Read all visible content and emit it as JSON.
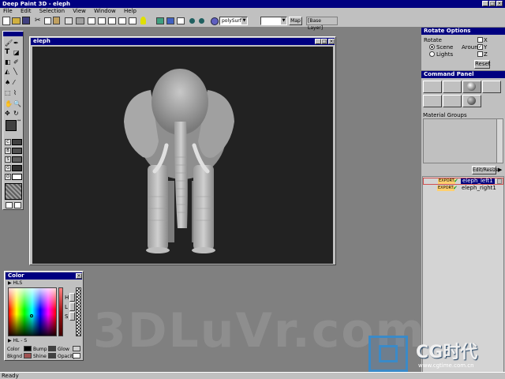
{
  "app": {
    "title": "Deep Paint 3D - eleph",
    "title_controls": [
      "_",
      "□",
      "×"
    ]
  },
  "menu": [
    "File",
    "Edit",
    "Selection",
    "View",
    "Window",
    "Help"
  ],
  "toolbar": {
    "surface_select": "polySurfac",
    "map_select": "",
    "map_button": "Map",
    "layer_label": "[Base Layer]"
  },
  "viewport": {
    "title": "eleph"
  },
  "rotate_options": {
    "title": "Rotate Options",
    "rotate_label": "Rotate",
    "scene_label": "Scene",
    "lights_label": "Lights",
    "around_label": "Around",
    "x_label": "X",
    "y_label": "Y",
    "z_label": "Z",
    "reset_label": "Reset",
    "selected_rotate": "Scene",
    "checked_axis": "Y"
  },
  "command_panel": {
    "title": "Command Panel",
    "material_groups_label": "Material Groups",
    "edit_resize_label": "Edit/Resize"
  },
  "layers": [
    {
      "tag": "EXPORT",
      "name": "eleph_left1",
      "selected": true
    },
    {
      "tag": "EXPORT",
      "name": "eleph_right1",
      "selected": false
    }
  ],
  "color_panel": {
    "title": "Color",
    "mode_top": "HLS",
    "mode_bottom": "HL - S",
    "slider_h": "H",
    "slider_l": "L",
    "slider_s": "S",
    "labels": {
      "color": "Color",
      "bump": "Bump",
      "glow": "Glow",
      "bkgnd": "Bkgnd",
      "shine": "Shine",
      "opacity": "Opacity"
    },
    "swatch_colors": {
      "color": "#000000",
      "bump": "#a05050",
      "glow": "#404040",
      "bkgnd": "#d0d0d0",
      "shine": "#404040",
      "opacity": "#ffffff"
    }
  },
  "watermark": {
    "left_text": "3DLuVr.com",
    "brand_text": "CG时代",
    "brand_url": "www.cgtime.com.cn"
  },
  "status": {
    "text": "Ready"
  },
  "colors": {
    "titlebar": "#000080",
    "workspace": "#808080",
    "viewport_bg": "#222222",
    "selected_layer": "#000080",
    "export_tag": "#ffd070"
  }
}
